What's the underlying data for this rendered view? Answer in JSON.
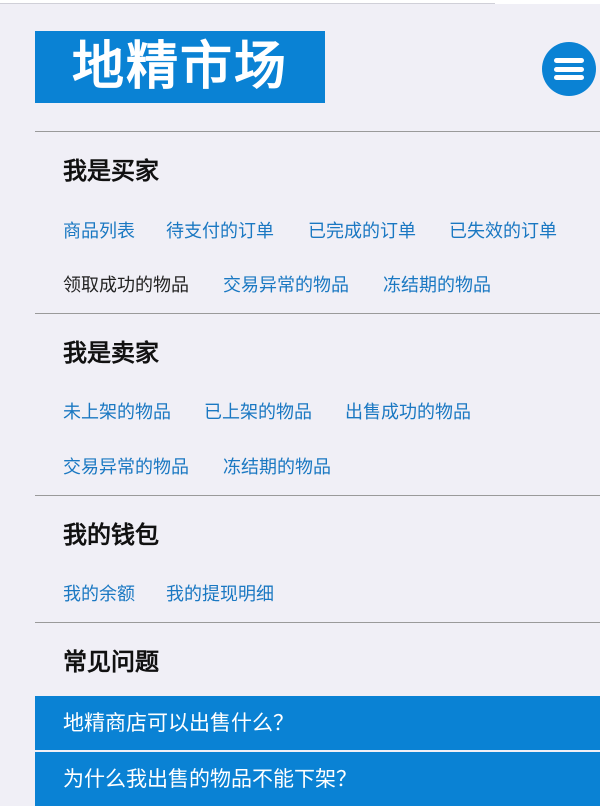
{
  "header": {
    "logo_text": "地精市场",
    "brand_color": "#0a82d4",
    "menu_icon": "hamburger-menu-icon"
  },
  "buyer": {
    "title": "我是买家",
    "links": [
      "商品列表",
      "待支付的订单",
      "已完成的订单",
      "已失效的订单",
      "领取成功的物品",
      "交易异常的物品",
      "冻结期的物品"
    ],
    "active_link": "领取成功的物品"
  },
  "seller": {
    "title": "我是卖家",
    "links": [
      "未上架的物品",
      "已上架的物品",
      "出售成功的物品",
      "交易异常的物品",
      "冻结期的物品"
    ]
  },
  "wallet": {
    "title": "我的钱包",
    "links": [
      "我的余额",
      "我的提现明细"
    ]
  },
  "faq": {
    "title": "常见问题",
    "items": [
      "地精商店可以出售什么？",
      "为什么我出售的物品不能下架？"
    ]
  },
  "colors": {
    "link": "#1a78c2",
    "active_link": "#222222",
    "background": "#f0eff6"
  }
}
